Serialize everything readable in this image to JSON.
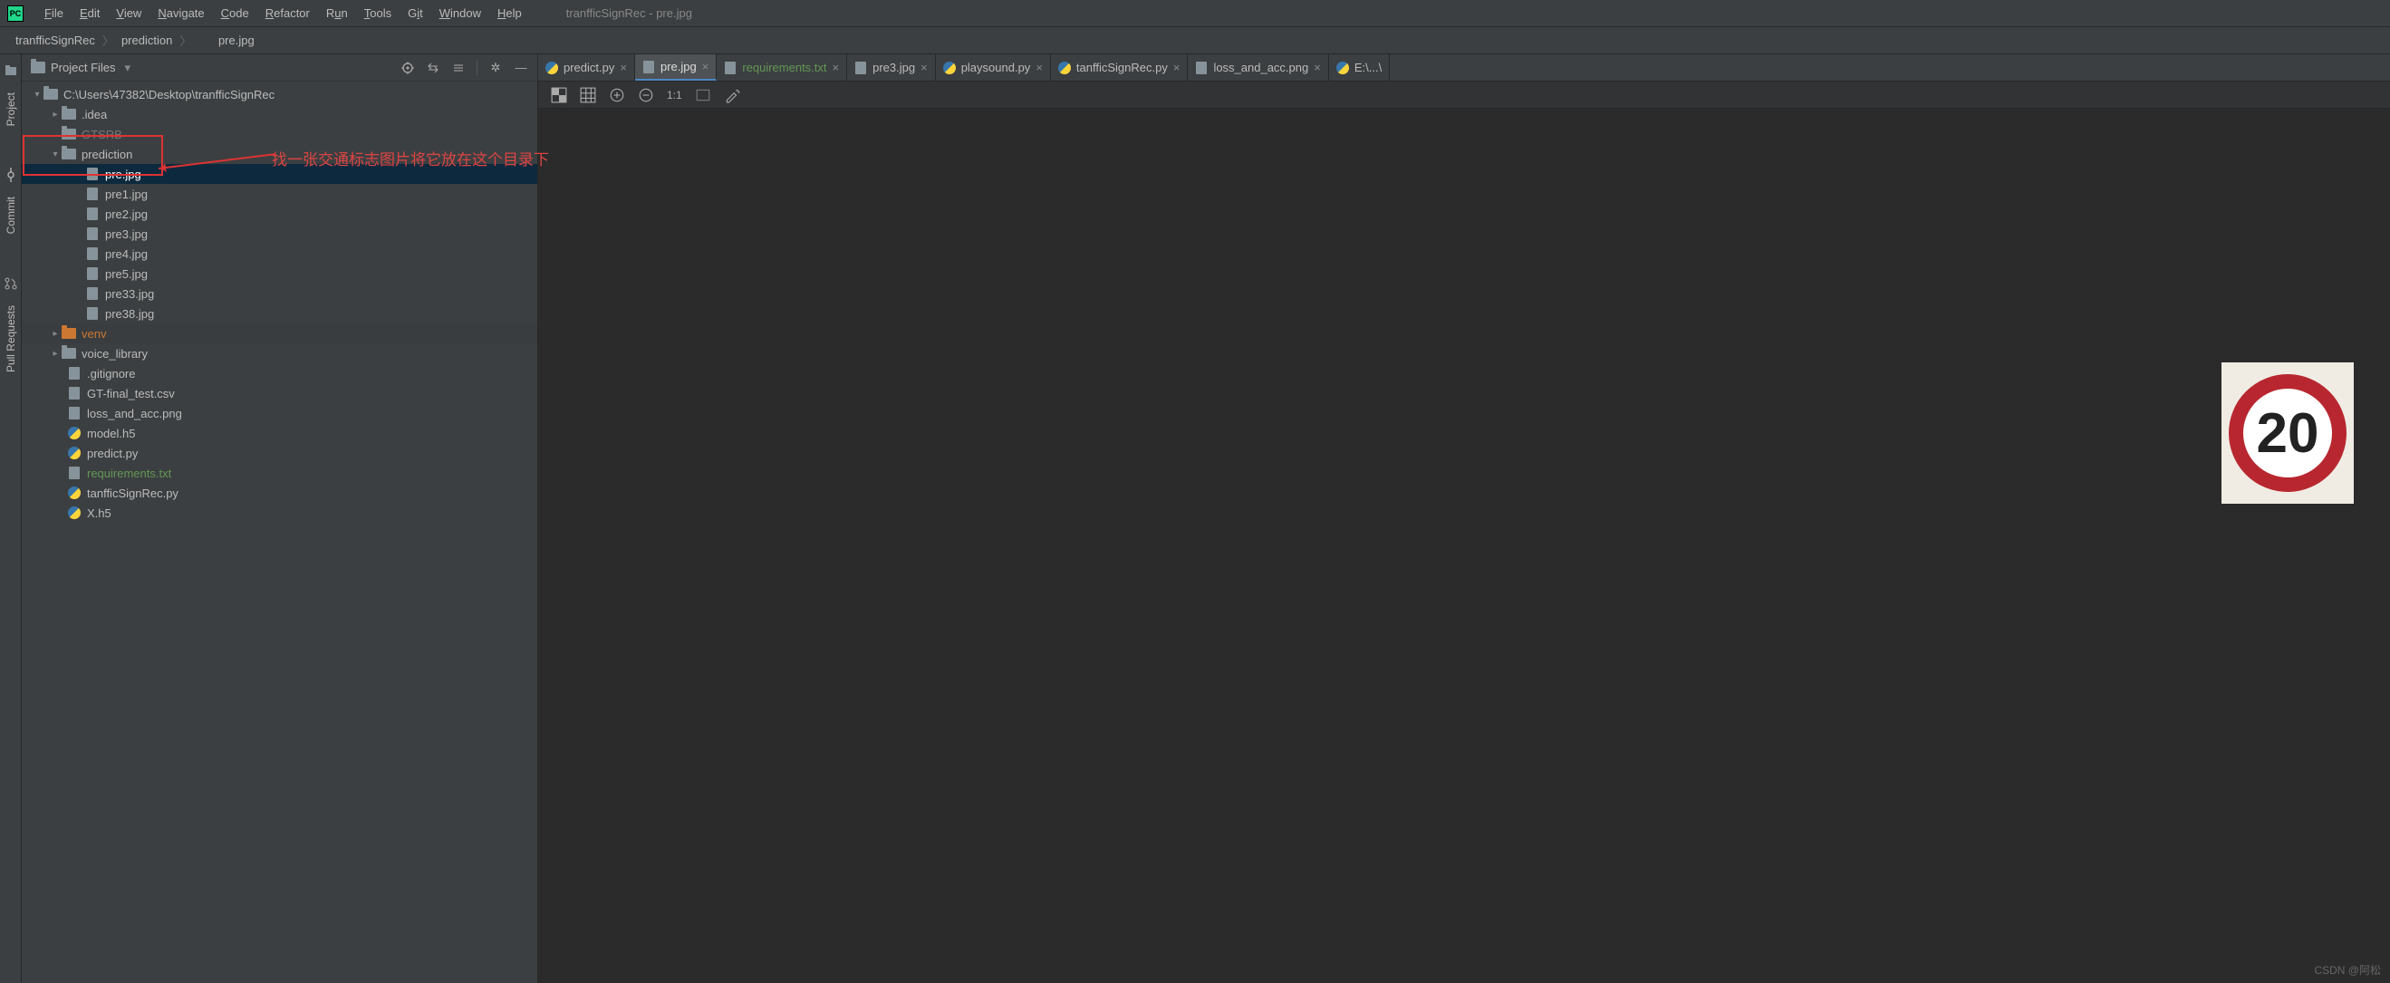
{
  "window_title": "tranfficSignRec - pre.jpg",
  "menu": [
    "File",
    "Edit",
    "View",
    "Navigate",
    "Code",
    "Refactor",
    "Run",
    "Tools",
    "Git",
    "Window",
    "Help"
  ],
  "breadcrumb": {
    "root": "tranfficSignRec",
    "mid": "prediction",
    "leaf": "pre.jpg"
  },
  "sidebar_header": {
    "title": "Project Files"
  },
  "left_rail": {
    "project": "Project",
    "commit": "Commit",
    "pull": "Pull Requests"
  },
  "tree": {
    "root": "C:\\Users\\47382\\Desktop\\tranfficSignRec",
    "idea": ".idea",
    "gtsrb": "GTSRB",
    "prediction": "prediction",
    "pre": "pre.jpg",
    "pre1": "pre1.jpg",
    "pre2": "pre2.jpg",
    "pre3": "pre3.jpg",
    "pre4": "pre4.jpg",
    "pre5": "pre5.jpg",
    "pre33": "pre33.jpg",
    "pre38": "pre38.jpg",
    "venv": "venv",
    "voice": "voice_library",
    "gitignore": ".gitignore",
    "gtfinal": "GT-final_test.csv",
    "lossacc": "loss_and_acc.png",
    "modelh5": "model.h5",
    "predictpy": "predict.py",
    "reqs": "requirements.txt",
    "tansign": "tanfficSignRec.py",
    "xh5": "X.h5"
  },
  "tabs": [
    {
      "label": "predict.py",
      "kind": "py",
      "active": false
    },
    {
      "label": "pre.jpg",
      "kind": "img",
      "active": true
    },
    {
      "label": "requirements.txt",
      "kind": "txt",
      "active": false,
      "green": true
    },
    {
      "label": "pre3.jpg",
      "kind": "img",
      "active": false
    },
    {
      "label": "playsound.py",
      "kind": "py",
      "active": false
    },
    {
      "label": "tanfficSignRec.py",
      "kind": "py",
      "active": false
    },
    {
      "label": "loss_and_acc.png",
      "kind": "img",
      "active": false
    },
    {
      "label": "E:\\...\\",
      "kind": "py",
      "active": false
    }
  ],
  "img_toolbar": {
    "ratio": "1:1"
  },
  "sign_value": "20",
  "annotation": "找一张交通标志图片将它放在这个目录下",
  "watermark": "CSDN @阿松"
}
